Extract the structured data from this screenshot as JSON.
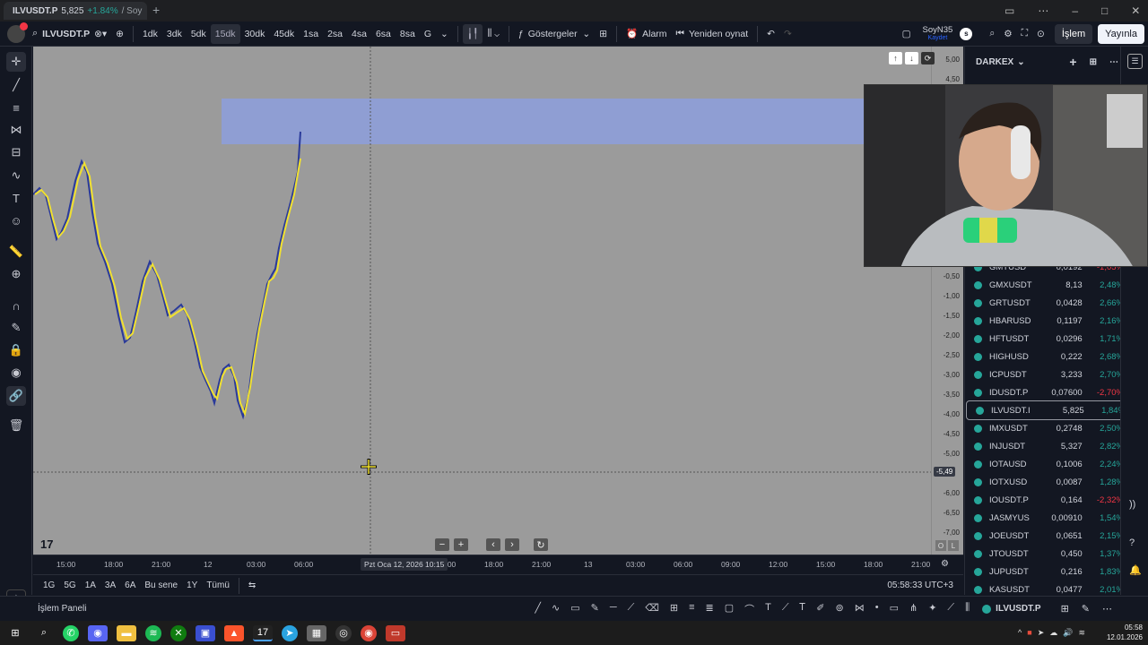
{
  "browser": {
    "tab_title": "ILVUSDT.P",
    "tab_price": "5,825",
    "tab_change": "+1.84%",
    "tab_suffix": "/ Soy"
  },
  "toolbar": {
    "symbol": "ILVUSDT.P",
    "intervals": [
      "1dk",
      "3dk",
      "5dk",
      "15dk",
      "30dk",
      "45dk",
      "1sa",
      "2sa",
      "4sa",
      "6sa",
      "8sa",
      "G"
    ],
    "active_interval": "15dk",
    "indicators_label": "Göstergeler",
    "alarm_label": "Alarm",
    "replay_label": "Yeniden oynat",
    "layout_name": "SoyN35",
    "layout_status": "Kaydet",
    "avatar_letter": "s",
    "trade_label": "İşlem",
    "publish_label": "Yayınla"
  },
  "chart": {
    "price_labels": [
      "5,00",
      "4,50",
      "-0,50",
      "-1,00",
      "-1,50",
      "-2,00",
      "-2,50",
      "-3,00",
      "-3,50",
      "-4,00",
      "-4,50",
      "-5,00",
      "-6,00",
      "-6,50",
      "-7,00"
    ],
    "crosshair_price": "-5,49",
    "crosshair_time": "Pzt Oca 12, 2026  10:15",
    "time_labels": [
      "15:00",
      "18:00",
      "21:00",
      "12",
      "03:00",
      "06:00",
      "15:00",
      "18:00",
      "21:00",
      "13",
      "03:00",
      "06:00",
      "09:00",
      "12:00",
      "15:00",
      "18:00",
      "21:00"
    ],
    "axis_buttons": [
      "O",
      "L"
    ],
    "colors": {
      "background": "#9b9b9b",
      "zone": "#8f9ed3",
      "line_yellow": "#f0e030",
      "line_blue": "#2a3a9a"
    }
  },
  "range_bar": {
    "ranges": [
      "1G",
      "5G",
      "1A",
      "3A",
      "6A",
      "Bu sene",
      "1Y",
      "Tümü"
    ],
    "clock": "05:58:33 UTC+3"
  },
  "watchlist": {
    "title": "DARKEX",
    "rows": [
      {
        "symbol": "GMTUSD",
        "last": "0,0192",
        "change": "-1,05%",
        "dir": "dn"
      },
      {
        "symbol": "GMXUSDT",
        "last": "8,13",
        "change": "2,48%",
        "dir": "up"
      },
      {
        "symbol": "GRTUSDT",
        "last": "0,0428",
        "change": "2,66%",
        "dir": "up"
      },
      {
        "symbol": "HBARUSD",
        "last": "0,1197",
        "change": "2,16%",
        "dir": "up"
      },
      {
        "symbol": "HFTUSDT",
        "last": "0,0296",
        "change": "1,71%",
        "dir": "up"
      },
      {
        "symbol": "HIGHUSD",
        "last": "0,222",
        "change": "2,68%",
        "dir": "up"
      },
      {
        "symbol": "ICPUSDT",
        "last": "3,233",
        "change": "2,70%",
        "dir": "up"
      },
      {
        "symbol": "IDUSDT.P",
        "last": "0,07600",
        "change": "-2,70%",
        "dir": "dn"
      },
      {
        "symbol": "ILVUSDT.I",
        "last": "5,825",
        "change": "1,84%",
        "dir": "up"
      },
      {
        "symbol": "IMXUSDT",
        "last": "0,2748",
        "change": "2,50%",
        "dir": "up"
      },
      {
        "symbol": "INJUSDT",
        "last": "5,327",
        "change": "2,82%",
        "dir": "up"
      },
      {
        "symbol": "IOTAUSD",
        "last": "0,1006",
        "change": "2,24%",
        "dir": "up"
      },
      {
        "symbol": "IOTXUSD",
        "last": "0,0087",
        "change": "1,28%",
        "dir": "up"
      },
      {
        "symbol": "IOUSDT.P",
        "last": "0,164",
        "change": "-2,32%",
        "dir": "dn"
      },
      {
        "symbol": "JASMYUS",
        "last": "0,00910",
        "change": "1,54%",
        "dir": "up"
      },
      {
        "symbol": "JOEUSDT",
        "last": "0,0651",
        "change": "2,15%",
        "dir": "up"
      },
      {
        "symbol": "JTOUSDT",
        "last": "0,450",
        "change": "1,37%",
        "dir": "up"
      },
      {
        "symbol": "JUPUSDT",
        "last": "0,216",
        "change": "1,83%",
        "dir": "up"
      },
      {
        "symbol": "KASUSDT",
        "last": "0,0477",
        "change": "2,01%",
        "dir": "up"
      }
    ]
  },
  "bottom": {
    "panel_label": "İşlem Paneli",
    "symbol": "ILVUSDT.P"
  },
  "taskbar": {
    "time": "05:58",
    "date": "12.01.2026"
  }
}
